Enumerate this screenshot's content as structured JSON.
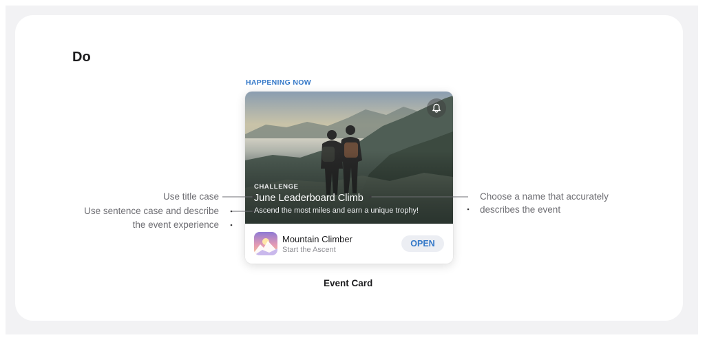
{
  "heading": "Do",
  "eyebrow": "HAPPENING NOW",
  "card": {
    "kicker": "CHALLENGE",
    "title": "June Leaderboard Climb",
    "description": "Ascend the most miles and earn a unique trophy!",
    "notify_icon": "bell-icon",
    "app": {
      "name": "Mountain Climber",
      "subtitle": "Start the Ascent",
      "icon": "mountain-app-icon",
      "button_label": "OPEN"
    }
  },
  "annotations": {
    "title_case": "Use title case",
    "sentence_case_line1": "Use sentence case and describe",
    "sentence_case_line2": "the event experience",
    "name_line1": "Choose a name that accurately",
    "name_line2": "describes the event"
  },
  "caption": "Event Card",
  "colors": {
    "accent": "#3478c8",
    "annotation_text": "#6e6e73",
    "background": "#f2f2f4"
  }
}
